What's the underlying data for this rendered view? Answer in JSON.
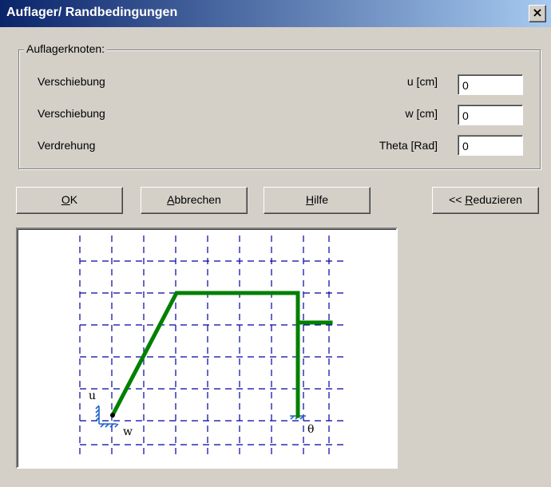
{
  "window": {
    "title": "Auflager/ Randbedingungen",
    "close_glyph": "×"
  },
  "group": {
    "legend": "Auflagerknoten:",
    "rows": [
      {
        "label": "Verschiebung",
        "unit": "u [cm]",
        "value": "0"
      },
      {
        "label": "Verschiebung",
        "unit": "w [cm]",
        "value": "0"
      },
      {
        "label": "Verdrehung",
        "unit": "Theta [Rad]",
        "value": "0"
      }
    ]
  },
  "buttons": {
    "ok_mnemonic": "O",
    "ok_rest": "K",
    "cancel_mnemonic": "A",
    "cancel_rest": "bbrechen",
    "help_mnemonic": "H",
    "help_rest": "ilfe",
    "reduce_prefix": "<< ",
    "reduce_mnemonic": "R",
    "reduce_rest": "eduzieren"
  },
  "diagram": {
    "support_labels": {
      "u": "u",
      "w": "w",
      "theta": "θ"
    },
    "colors": {
      "grid": "#0000a0",
      "frame": "#008000",
      "support": "#1e64c8"
    }
  }
}
